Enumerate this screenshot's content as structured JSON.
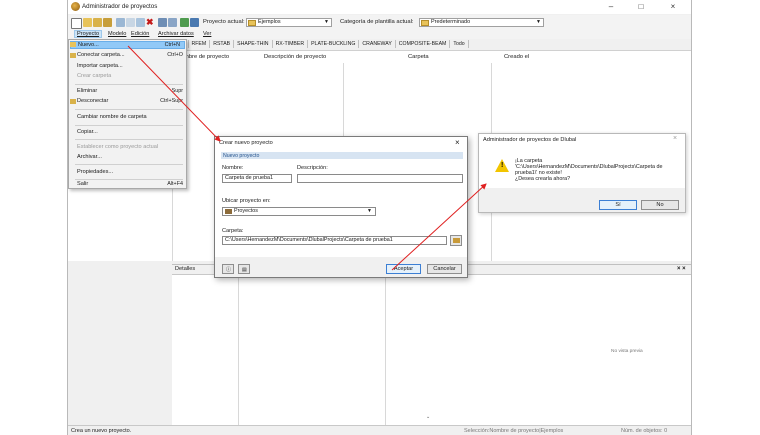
{
  "window": {
    "title": "Administrador de proyectos",
    "minimize": "–",
    "maximize": "□",
    "close": "×"
  },
  "toolbar": {
    "project_label": "Proyecto actual:",
    "project_value": "Ejemplos",
    "template_label": "Categoría de plantilla actual:",
    "template_value": "Predeterminado"
  },
  "menu": {
    "items": [
      "Proyecto",
      "Modelo",
      "Edición",
      "Archivar datos",
      "Ver"
    ]
  },
  "tabs": [
    "ytos",
    "RFEM",
    "RSTAB",
    "SHAPE-THIN",
    "RX-TIMBER",
    "PLATE-BUCKLING",
    "CRANEWAY",
    "COMPOSITE-BEAM",
    "Todo"
  ],
  "columns": [
    "mbre de proyecto",
    "Descripción de proyecto",
    "Carpeta",
    "Creado el"
  ],
  "dropdown": {
    "items": [
      {
        "label": "Nuevo...",
        "shortcut": "Ctrl+N"
      },
      {
        "label": "Conectar carpeta...",
        "shortcut": "Ctrl+O"
      },
      {
        "label": "Importar carpeta...",
        "shortcut": ""
      },
      {
        "label": "Crear carpeta",
        "shortcut": ""
      },
      {
        "label": "Eliminar",
        "shortcut": "Supr"
      },
      {
        "label": "Desconectar",
        "shortcut": "Ctrl+Supr"
      },
      {
        "label": "Cambiar nombre de carpeta",
        "shortcut": ""
      },
      {
        "label": "Copiar...",
        "shortcut": ""
      },
      {
        "label": "Establecer como proyecto actual",
        "shortcut": ""
      },
      {
        "label": "Archivar...",
        "shortcut": ""
      },
      {
        "label": "Propiedades...",
        "shortcut": ""
      },
      {
        "label": "Salir",
        "shortcut": "Alt+F4"
      }
    ]
  },
  "details": {
    "title": "Detalles",
    "preview": "No vista previa",
    "close": "× ×"
  },
  "status": {
    "left": "Crea un nuevo proyecto.",
    "middle": "Selección:Nombre de proyecto|Ejemplos",
    "right": "Núm. de objetos: 0"
  },
  "dialog": {
    "title": "Crear nuevo proyecto",
    "close": "×",
    "section": "Nuevo proyecto",
    "name_label": "Nombre:",
    "name_value": "Carpeta de prueba1",
    "desc_label": "Descripción:",
    "desc_value": "",
    "location_label": "Ubicar proyecto en:",
    "location_value": "Proyectos",
    "folder_label": "Carpeta:",
    "folder_value": "C:\\Users\\HernandezM\\Documents\\DlubalProjects\\Carpeta de prueba1",
    "ok": "Aceptar",
    "cancel": "Cancelar"
  },
  "message": {
    "title": "Administrador de proyectos de Dlubal",
    "close": "×",
    "line1": "¡La carpeta",
    "line2": "'C:\\Users\\HernandezM\\Documents\\DlubalProjects\\Carpeta de",
    "line3": "prueba1\\' no existe!",
    "line4": "¿Desea crearla ahora?",
    "yes": "Sí",
    "no": "No"
  },
  "colors": {
    "accent": "#91c9f7",
    "arrow": "#e02020",
    "warning": "#f2c500"
  }
}
